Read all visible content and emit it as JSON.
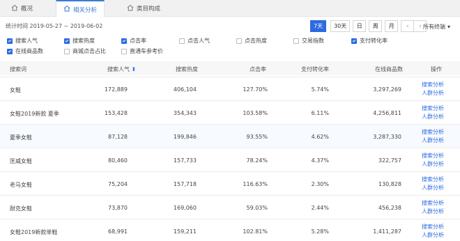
{
  "tabs": [
    {
      "label": "概况",
      "icon": "house-icon",
      "active": false
    },
    {
      "label": "相关分析",
      "icon": "house-icon",
      "active": true
    },
    {
      "label": "类目构成",
      "icon": "house-icon",
      "active": false
    }
  ],
  "date_range": {
    "label": "统计时间 2019-05-27 ~ 2019-06-02"
  },
  "period_buttons": [
    {
      "label": "7天",
      "active": true
    },
    {
      "label": "30天",
      "active": false
    },
    {
      "label": "日",
      "active": false
    },
    {
      "label": "周",
      "active": false
    },
    {
      "label": "月",
      "active": false
    }
  ],
  "pager": {
    "prev": "‹",
    "next": "›"
  },
  "terminal_select": {
    "label": "所有终端",
    "caret": "▾"
  },
  "filters": [
    {
      "label": "搜索人气",
      "checked": true
    },
    {
      "label": "搜索热度",
      "checked": true
    },
    {
      "label": "点击率",
      "checked": true
    },
    {
      "label": "点击人气",
      "checked": false
    },
    {
      "label": "点击热度",
      "checked": false
    },
    {
      "label": "交易指数",
      "checked": false
    },
    {
      "label": "支付转化率",
      "checked": true
    },
    {
      "label": "在线商品数",
      "checked": true
    },
    {
      "label": "商城点击占比",
      "checked": false
    },
    {
      "label": "直通车参考价",
      "checked": false
    }
  ],
  "columns": {
    "keyword": "搜索词",
    "search_popularity": "搜索人气",
    "search_heat": "搜索热度",
    "ctr": "点击率",
    "conversion": "支付转化率",
    "online_items": "在线商品数",
    "actions": "操作"
  },
  "sort_indicator": "⬍",
  "action_labels": {
    "analyze": "搜索分析",
    "crowd": "人群分析"
  },
  "rows": [
    {
      "keyword": "女鞋",
      "search_popularity": "172,889",
      "search_heat": "406,104",
      "ctr": "127.70%",
      "conversion": "5.74%",
      "online_items": "3,297,269"
    },
    {
      "keyword": "女鞋2019新款 夏季",
      "search_popularity": "153,428",
      "search_heat": "354,343",
      "ctr": "103.58%",
      "conversion": "6.11%",
      "online_items": "4,256,811"
    },
    {
      "keyword": "夏季女鞋",
      "search_popularity": "87,128",
      "search_heat": "199,846",
      "ctr": "93.55%",
      "conversion": "4.62%",
      "online_items": "3,287,330"
    },
    {
      "keyword": "匡威女鞋",
      "search_popularity": "80,460",
      "search_heat": "157,733",
      "ctr": "78.24%",
      "conversion": "4.37%",
      "online_items": "322,757"
    },
    {
      "keyword": "老马女鞋",
      "search_popularity": "75,204",
      "search_heat": "157,718",
      "ctr": "116.63%",
      "conversion": "2.30%",
      "online_items": "130,828"
    },
    {
      "keyword": "耐克女鞋",
      "search_popularity": "73,870",
      "search_heat": "169,060",
      "ctr": "59.03%",
      "conversion": "2.44%",
      "online_items": "456,238"
    },
    {
      "keyword": "女鞋2019新款单鞋",
      "search_popularity": "68,991",
      "search_heat": "159,211",
      "ctr": "102.81%",
      "conversion": "5.28%",
      "online_items": "1,411,287"
    }
  ],
  "colors": {
    "accent": "#2d6ae0",
    "checkbox_checked": "#2d6ae0",
    "link": "#2d6ae0"
  }
}
